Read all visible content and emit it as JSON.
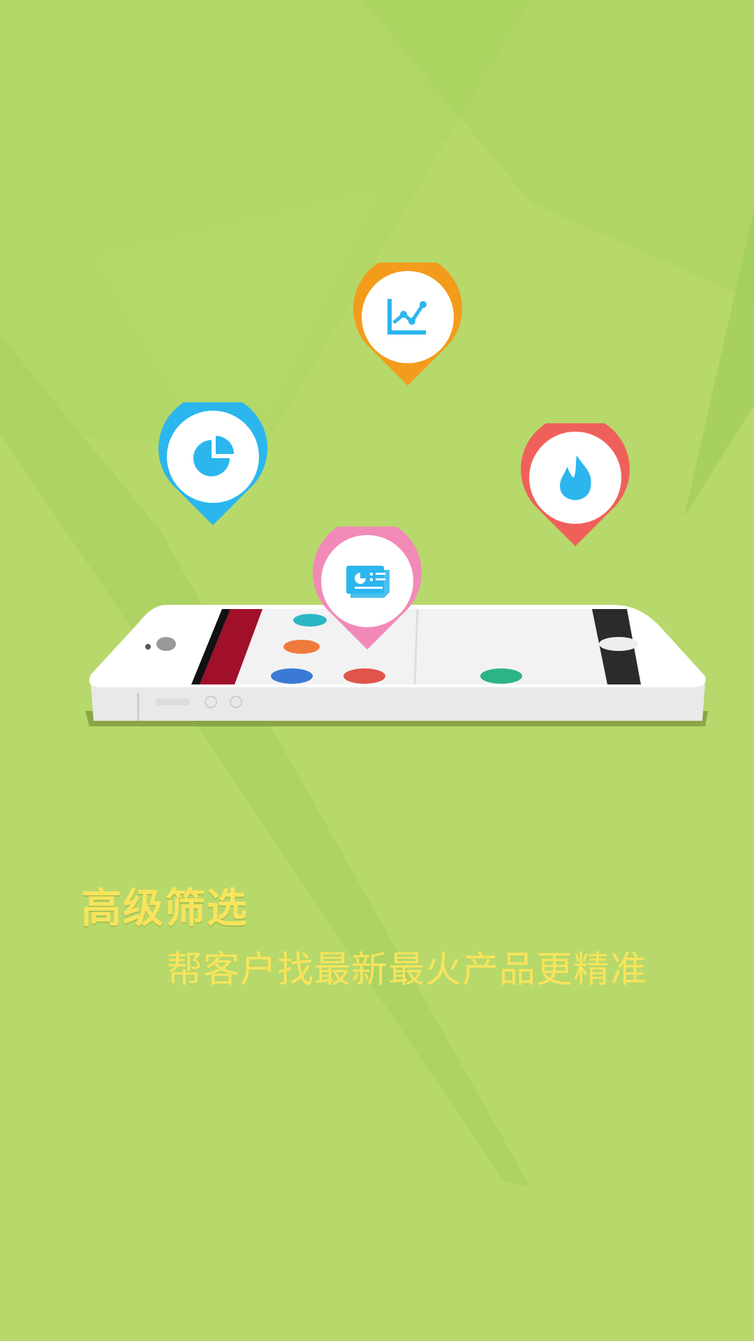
{
  "headline": "高级筛选",
  "subline": "帮客户找最新最火产品更精准",
  "colors": {
    "background": "#b7d86b",
    "text_accent": "#f7e45c",
    "pin_orange": "#f39c1b",
    "pin_blue": "#2bb6ee",
    "pin_red": "#f0605a",
    "pin_pink": "#f28ab8",
    "icon_blue": "#2bb6ee"
  },
  "pins": [
    {
      "name": "trend-chart-icon",
      "color": "orange"
    },
    {
      "name": "pie-chart-icon",
      "color": "blue"
    },
    {
      "name": "fire-icon",
      "color": "red"
    },
    {
      "name": "report-card-icon",
      "color": "pink"
    }
  ]
}
